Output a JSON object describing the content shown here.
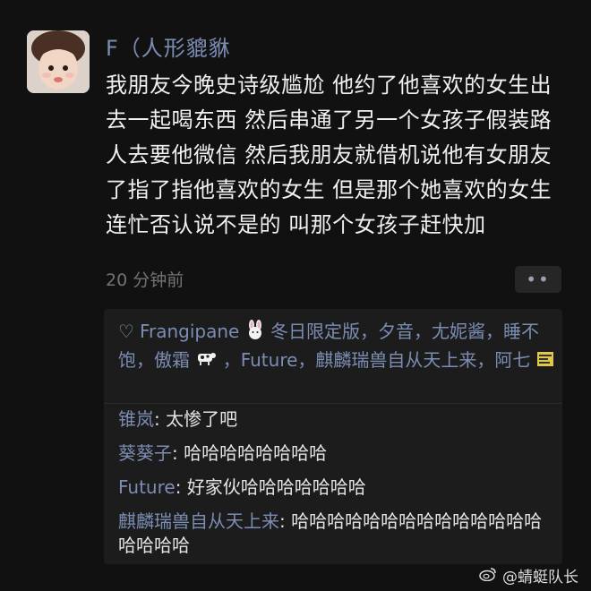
{
  "post": {
    "username": "F（人形貔貅",
    "text": "我朋友今晚史诗级尴尬 他约了他喜欢的女生出去一起喝东西 然后串通了另一个女孩子假装路人去要他微信 然后我朋友就借机说他有女朋友了指了指他喜欢的女生 但是那个她喜欢的女生连忙否认说不是的 叫那个女孩子赶快加",
    "timestamp": "20 分钟前"
  },
  "likes": {
    "part1": "Frangipane",
    "part2": "冬日限定版，夕音，尢妮酱，睡不饱，傲霜",
    "part3": "，Future，麒麟瑞兽自从天上来，阿七"
  },
  "comments": [
    {
      "author": "锥岚",
      "text": "太惨了吧"
    },
    {
      "author": "葵葵子",
      "text": "哈哈哈哈哈哈哈哈"
    },
    {
      "author": "Future",
      "text": "好家伙哈哈哈哈哈哈哈"
    },
    {
      "author": "麒麟瑞兽自从天上来",
      "text": "哈哈哈哈哈哈哈哈哈哈哈哈哈哈哈哈哈哈"
    }
  ],
  "watermark": "@蜻蜓队长",
  "icons": {
    "like": "heart-icon",
    "more": "more-dots-icon",
    "watermark": "weibo-icon"
  },
  "colors": {
    "background": "#111111",
    "name": "#7c8db4",
    "text": "#f0f0f0",
    "muted": "#737373",
    "comment_bg": "#1c1c1c"
  }
}
